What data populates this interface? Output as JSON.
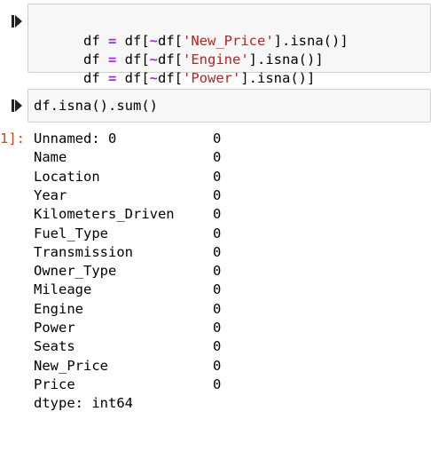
{
  "cell1": {
    "run_icon": "run-cell-icon",
    "lines": [
      {
        "a": "df ",
        "op": "=",
        "b": " df[",
        "tilde": "~",
        "c": "df[",
        "s": "'New_Price'",
        "d": "].isna()]"
      },
      {
        "a": "df ",
        "op": "=",
        "b": " df[",
        "tilde": "~",
        "c": "df[",
        "s": "'Engine'",
        "d": "].isna()]"
      },
      {
        "a": "df ",
        "op": "=",
        "b": " df[",
        "tilde": "~",
        "c": "df[",
        "s": "'Power'",
        "d": "].isna()]"
      }
    ]
  },
  "cell2": {
    "run_icon": "run-cell-icon",
    "code": "df.isna().sum()"
  },
  "output": {
    "prompt": "1]:",
    "rows": [
      {
        "name": "Unnamed: 0",
        "value": "0"
      },
      {
        "name": "Name",
        "value": "0"
      },
      {
        "name": "Location",
        "value": "0"
      },
      {
        "name": "Year",
        "value": "0"
      },
      {
        "name": "Kilometers_Driven",
        "value": "0"
      },
      {
        "name": "Fuel_Type",
        "value": "0"
      },
      {
        "name": "Transmission",
        "value": "0"
      },
      {
        "name": "Owner_Type",
        "value": "0"
      },
      {
        "name": "Mileage",
        "value": "0"
      },
      {
        "name": "Engine",
        "value": "0"
      },
      {
        "name": "Power",
        "value": "0"
      },
      {
        "name": "Seats",
        "value": "0"
      },
      {
        "name": "New_Price",
        "value": "0"
      },
      {
        "name": "Price",
        "value": "0"
      }
    ],
    "dtype": "dtype: int64"
  },
  "colors": {
    "operator": "#aa22ff",
    "string": "#ba2121",
    "prompt": "#d84315",
    "code_bg": "#f7f7f7"
  }
}
